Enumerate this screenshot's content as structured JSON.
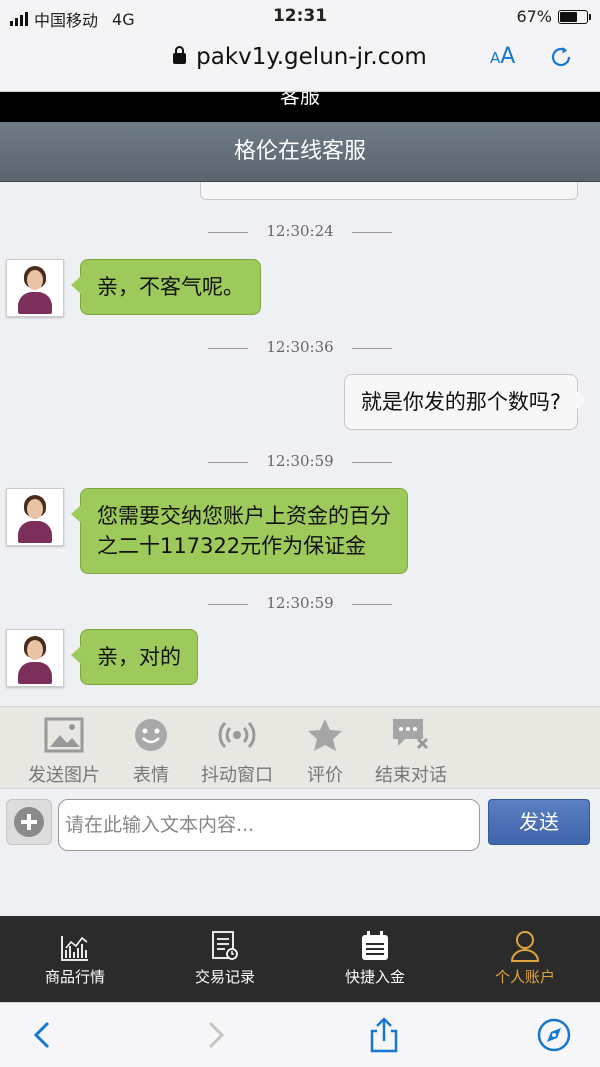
{
  "status_bar": {
    "carrier": "中国移动",
    "network": "4G",
    "time": "12:31",
    "battery": "67%",
    "battery_level": 0.67
  },
  "browser": {
    "url": "pakv1y.gelun-jr.com",
    "text_size_label": "AA",
    "accent_color": "#1677d2"
  },
  "page": {
    "cut_title": "客服",
    "chat_title": "格伦在线客服"
  },
  "messages": [
    {
      "timestamp": "12:30:24",
      "side": "left",
      "text": "亲，不客气呢。"
    },
    {
      "timestamp": "12:30:36",
      "side": "right",
      "text": "就是你发的那个数吗?"
    },
    {
      "timestamp": "12:30:59",
      "side": "left",
      "text_lines": [
        "您需要交纳您账户上资金的百分",
        "之二十117322元作为保证金"
      ]
    },
    {
      "timestamp": "12:30:59",
      "side": "left",
      "text": "亲，对的"
    }
  ],
  "toolbar": {
    "items": [
      {
        "label": "发送图片",
        "icon": "image-icon"
      },
      {
        "label": "表情",
        "icon": "smiley-icon"
      },
      {
        "label": "抖动窗口",
        "icon": "vibrate-icon"
      },
      {
        "label": "评价",
        "icon": "star-icon"
      },
      {
        "label": "结束对话",
        "icon": "end-chat-icon"
      }
    ]
  },
  "composer": {
    "placeholder": "请在此输入文本内容...",
    "send_label": "发送"
  },
  "app_nav": {
    "items": [
      {
        "label": "商品行情",
        "icon": "chart-icon"
      },
      {
        "label": "交易记录",
        "icon": "record-icon"
      },
      {
        "label": "快捷入金",
        "icon": "calendar-icon"
      },
      {
        "label": "个人账户",
        "icon": "user-icon",
        "active": true
      }
    ],
    "active_color": "#e0a43c"
  }
}
